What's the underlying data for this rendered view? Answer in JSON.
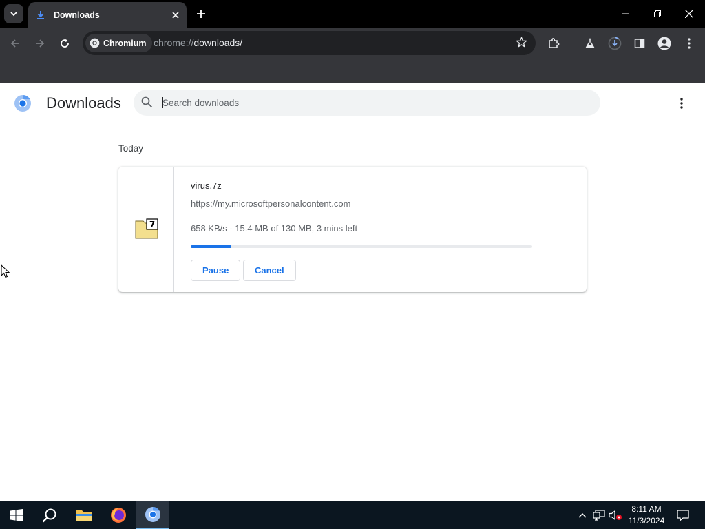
{
  "browser": {
    "tab_title": "Downloads",
    "chip_label": "Chromium",
    "url_scheme": "chrome://",
    "url_path": "downloads/"
  },
  "page": {
    "title": "Downloads",
    "search_placeholder": "Search downloads",
    "section_label": "Today"
  },
  "download": {
    "filename": "virus.7z",
    "source_url": "https://my.microsoftpersonalcontent.com",
    "status": "658 KB/s - 15.4 MB of 130 MB, 3 mins left",
    "progress_fraction": 0.118,
    "pause_label": "Pause",
    "cancel_label": "Cancel",
    "file_icon": "7zip-archive-icon"
  },
  "taskbar": {
    "apps": [
      "start-icon",
      "search-icon",
      "file-explorer-icon",
      "firefox-icon",
      "chromium-icon"
    ],
    "time": "8:11 AM",
    "date": "11/3/2024"
  },
  "colors": {
    "accent": "#1a73e8",
    "titlebar": "#000000",
    "toolbar": "#35363a",
    "taskbar": "#0b1620"
  }
}
